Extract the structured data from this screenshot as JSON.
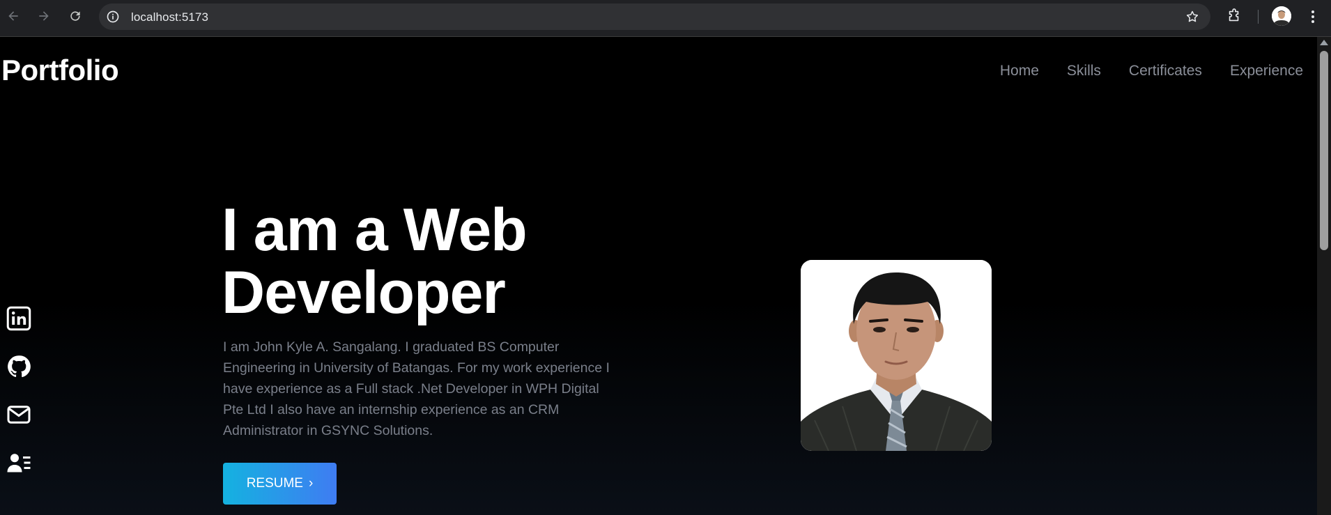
{
  "browser": {
    "url": "localhost:5173",
    "icons": {
      "back": "arrow-left-icon",
      "forward": "arrow-right-icon",
      "reload": "reload-icon",
      "info": "info-icon",
      "bookmark": "star-icon",
      "extensions": "puzzle-icon",
      "profile": "avatar",
      "menu": "kebab-menu-icon"
    }
  },
  "site": {
    "brand": "Portfolio",
    "nav": [
      {
        "label": "Home"
      },
      {
        "label": "Skills"
      },
      {
        "label": "Certificates"
      },
      {
        "label": "Experience"
      }
    ]
  },
  "hero": {
    "title_line1": "I am a Web",
    "title_line2": "Developer",
    "description": "I am John Kyle A. Sangalang. I graduated BS Computer Engineering in University of Batangas. For my work experience I have experience as a Full stack .Net Developer in WPH Digital Pte Ltd I also have an internship experience as an CRM Administrator in GSYNC Solutions.",
    "resume_label": "RESUME",
    "resume_arrow": "›"
  },
  "socials": [
    {
      "icon": "linkedin-icon"
    },
    {
      "icon": "github-icon"
    },
    {
      "icon": "mail-icon"
    },
    {
      "icon": "contact-card-icon"
    }
  ],
  "colors": {
    "nav_text": "#8b8f99",
    "desc_text": "#7a7f8a",
    "button_start": "#14b2e0",
    "button_end": "#3f7cf2"
  }
}
